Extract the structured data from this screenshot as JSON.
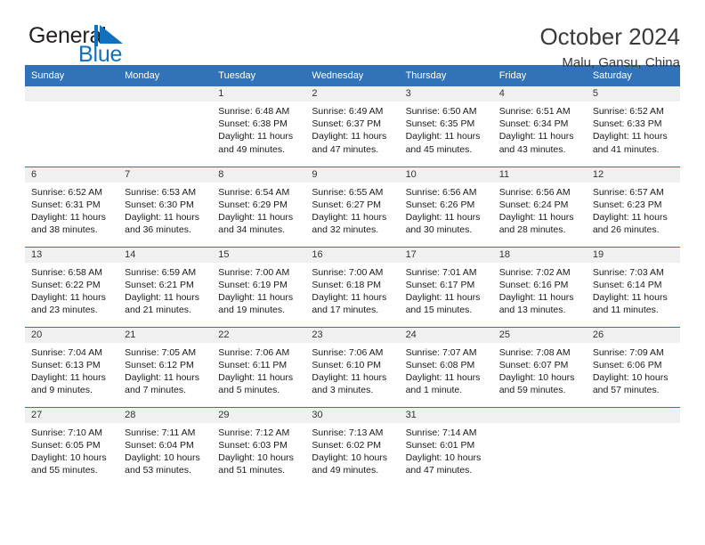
{
  "logo": {
    "word_one": "General",
    "word_two": "Blue",
    "mark": "triangle-sail-mark",
    "color_dark": "#231f20",
    "color_blue": "#1271bd"
  },
  "header": {
    "title": "October 2024",
    "subtitle": "Malu, Gansu, China"
  },
  "theme": {
    "header_blue": "#3172b9",
    "day_band_gray": "#f0f0f0",
    "text": "#1a1a1a"
  },
  "calendar": {
    "weekday_headers": [
      "Sunday",
      "Monday",
      "Tuesday",
      "Wednesday",
      "Thursday",
      "Friday",
      "Saturday"
    ],
    "weeks": [
      [
        {
          "day": "",
          "sunrise": "",
          "sunset": "",
          "daylight_1": "",
          "daylight_2": "",
          "empty": true
        },
        {
          "day": "",
          "sunrise": "",
          "sunset": "",
          "daylight_1": "",
          "daylight_2": "",
          "empty": true
        },
        {
          "day": "1",
          "sunrise": "Sunrise: 6:48 AM",
          "sunset": "Sunset: 6:38 PM",
          "daylight_1": "Daylight: 11 hours",
          "daylight_2": "and 49 minutes."
        },
        {
          "day": "2",
          "sunrise": "Sunrise: 6:49 AM",
          "sunset": "Sunset: 6:37 PM",
          "daylight_1": "Daylight: 11 hours",
          "daylight_2": "and 47 minutes."
        },
        {
          "day": "3",
          "sunrise": "Sunrise: 6:50 AM",
          "sunset": "Sunset: 6:35 PM",
          "daylight_1": "Daylight: 11 hours",
          "daylight_2": "and 45 minutes."
        },
        {
          "day": "4",
          "sunrise": "Sunrise: 6:51 AM",
          "sunset": "Sunset: 6:34 PM",
          "daylight_1": "Daylight: 11 hours",
          "daylight_2": "and 43 minutes."
        },
        {
          "day": "5",
          "sunrise": "Sunrise: 6:52 AM",
          "sunset": "Sunset: 6:33 PM",
          "daylight_1": "Daylight: 11 hours",
          "daylight_2": "and 41 minutes."
        }
      ],
      [
        {
          "day": "6",
          "sunrise": "Sunrise: 6:52 AM",
          "sunset": "Sunset: 6:31 PM",
          "daylight_1": "Daylight: 11 hours",
          "daylight_2": "and 38 minutes."
        },
        {
          "day": "7",
          "sunrise": "Sunrise: 6:53 AM",
          "sunset": "Sunset: 6:30 PM",
          "daylight_1": "Daylight: 11 hours",
          "daylight_2": "and 36 minutes."
        },
        {
          "day": "8",
          "sunrise": "Sunrise: 6:54 AM",
          "sunset": "Sunset: 6:29 PM",
          "daylight_1": "Daylight: 11 hours",
          "daylight_2": "and 34 minutes."
        },
        {
          "day": "9",
          "sunrise": "Sunrise: 6:55 AM",
          "sunset": "Sunset: 6:27 PM",
          "daylight_1": "Daylight: 11 hours",
          "daylight_2": "and 32 minutes."
        },
        {
          "day": "10",
          "sunrise": "Sunrise: 6:56 AM",
          "sunset": "Sunset: 6:26 PM",
          "daylight_1": "Daylight: 11 hours",
          "daylight_2": "and 30 minutes."
        },
        {
          "day": "11",
          "sunrise": "Sunrise: 6:56 AM",
          "sunset": "Sunset: 6:24 PM",
          "daylight_1": "Daylight: 11 hours",
          "daylight_2": "and 28 minutes."
        },
        {
          "day": "12",
          "sunrise": "Sunrise: 6:57 AM",
          "sunset": "Sunset: 6:23 PM",
          "daylight_1": "Daylight: 11 hours",
          "daylight_2": "and 26 minutes."
        }
      ],
      [
        {
          "day": "13",
          "sunrise": "Sunrise: 6:58 AM",
          "sunset": "Sunset: 6:22 PM",
          "daylight_1": "Daylight: 11 hours",
          "daylight_2": "and 23 minutes."
        },
        {
          "day": "14",
          "sunrise": "Sunrise: 6:59 AM",
          "sunset": "Sunset: 6:21 PM",
          "daylight_1": "Daylight: 11 hours",
          "daylight_2": "and 21 minutes."
        },
        {
          "day": "15",
          "sunrise": "Sunrise: 7:00 AM",
          "sunset": "Sunset: 6:19 PM",
          "daylight_1": "Daylight: 11 hours",
          "daylight_2": "and 19 minutes."
        },
        {
          "day": "16",
          "sunrise": "Sunrise: 7:00 AM",
          "sunset": "Sunset: 6:18 PM",
          "daylight_1": "Daylight: 11 hours",
          "daylight_2": "and 17 minutes."
        },
        {
          "day": "17",
          "sunrise": "Sunrise: 7:01 AM",
          "sunset": "Sunset: 6:17 PM",
          "daylight_1": "Daylight: 11 hours",
          "daylight_2": "and 15 minutes."
        },
        {
          "day": "18",
          "sunrise": "Sunrise: 7:02 AM",
          "sunset": "Sunset: 6:16 PM",
          "daylight_1": "Daylight: 11 hours",
          "daylight_2": "and 13 minutes."
        },
        {
          "day": "19",
          "sunrise": "Sunrise: 7:03 AM",
          "sunset": "Sunset: 6:14 PM",
          "daylight_1": "Daylight: 11 hours",
          "daylight_2": "and 11 minutes."
        }
      ],
      [
        {
          "day": "20",
          "sunrise": "Sunrise: 7:04 AM",
          "sunset": "Sunset: 6:13 PM",
          "daylight_1": "Daylight: 11 hours",
          "daylight_2": "and 9 minutes."
        },
        {
          "day": "21",
          "sunrise": "Sunrise: 7:05 AM",
          "sunset": "Sunset: 6:12 PM",
          "daylight_1": "Daylight: 11 hours",
          "daylight_2": "and 7 minutes."
        },
        {
          "day": "22",
          "sunrise": "Sunrise: 7:06 AM",
          "sunset": "Sunset: 6:11 PM",
          "daylight_1": "Daylight: 11 hours",
          "daylight_2": "and 5 minutes."
        },
        {
          "day": "23",
          "sunrise": "Sunrise: 7:06 AM",
          "sunset": "Sunset: 6:10 PM",
          "daylight_1": "Daylight: 11 hours",
          "daylight_2": "and 3 minutes."
        },
        {
          "day": "24",
          "sunrise": "Sunrise: 7:07 AM",
          "sunset": "Sunset: 6:08 PM",
          "daylight_1": "Daylight: 11 hours",
          "daylight_2": "and 1 minute."
        },
        {
          "day": "25",
          "sunrise": "Sunrise: 7:08 AM",
          "sunset": "Sunset: 6:07 PM",
          "daylight_1": "Daylight: 10 hours",
          "daylight_2": "and 59 minutes."
        },
        {
          "day": "26",
          "sunrise": "Sunrise: 7:09 AM",
          "sunset": "Sunset: 6:06 PM",
          "daylight_1": "Daylight: 10 hours",
          "daylight_2": "and 57 minutes."
        }
      ],
      [
        {
          "day": "27",
          "sunrise": "Sunrise: 7:10 AM",
          "sunset": "Sunset: 6:05 PM",
          "daylight_1": "Daylight: 10 hours",
          "daylight_2": "and 55 minutes."
        },
        {
          "day": "28",
          "sunrise": "Sunrise: 7:11 AM",
          "sunset": "Sunset: 6:04 PM",
          "daylight_1": "Daylight: 10 hours",
          "daylight_2": "and 53 minutes."
        },
        {
          "day": "29",
          "sunrise": "Sunrise: 7:12 AM",
          "sunset": "Sunset: 6:03 PM",
          "daylight_1": "Daylight: 10 hours",
          "daylight_2": "and 51 minutes."
        },
        {
          "day": "30",
          "sunrise": "Sunrise: 7:13 AM",
          "sunset": "Sunset: 6:02 PM",
          "daylight_1": "Daylight: 10 hours",
          "daylight_2": "and 49 minutes."
        },
        {
          "day": "31",
          "sunrise": "Sunrise: 7:14 AM",
          "sunset": "Sunset: 6:01 PM",
          "daylight_1": "Daylight: 10 hours",
          "daylight_2": "and 47 minutes."
        },
        {
          "day": "",
          "sunrise": "",
          "sunset": "",
          "daylight_1": "",
          "daylight_2": "",
          "empty": true
        },
        {
          "day": "",
          "sunrise": "",
          "sunset": "",
          "daylight_1": "",
          "daylight_2": "",
          "empty": true
        }
      ]
    ]
  }
}
